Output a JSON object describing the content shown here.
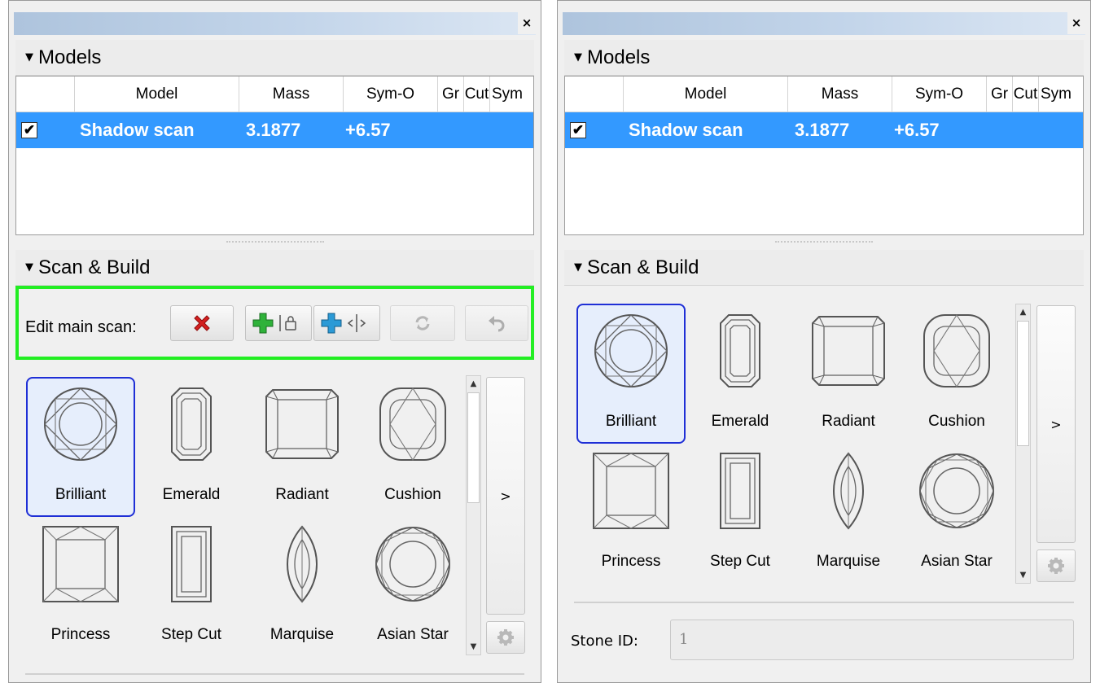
{
  "close_glyph": "×",
  "models": {
    "title": "Models",
    "columns": [
      "",
      "Model",
      "Mass",
      "Sym-O",
      "Gr",
      "Cut",
      "Sym"
    ],
    "rows": [
      {
        "checked": true,
        "check_glyph": "✔",
        "model": "Shadow scan",
        "mass": "3.1877",
        "sym_o": "+6.57"
      }
    ],
    "selection_color": "#3399ff"
  },
  "scan_build": {
    "title": "Scan & Build",
    "edit_label": "Edit main scan:",
    "buttons": [
      "delete-icon",
      "add-lock-icon",
      "add-mirror-icon",
      "refresh-icon",
      "undo-icon"
    ],
    "highlight_color": "#22ee22"
  },
  "cuts": [
    {
      "label": "Brilliant",
      "icon": "brilliant-cut-icon",
      "selected": true
    },
    {
      "label": "Emerald",
      "icon": "emerald-cut-icon",
      "selected": false
    },
    {
      "label": "Radiant",
      "icon": "radiant-cut-icon",
      "selected": false
    },
    {
      "label": "Cushion",
      "icon": "cushion-cut-icon",
      "selected": false
    },
    {
      "label": "Princess",
      "icon": "princess-cut-icon",
      "selected": false
    },
    {
      "label": "Step Cut",
      "icon": "step-cut-icon",
      "selected": false
    },
    {
      "label": "Marquise",
      "icon": "marquise-cut-icon",
      "selected": false
    },
    {
      "label": "Asian Star",
      "icon": "asian-star-cut-icon",
      "selected": false
    }
  ],
  "next_label": ">",
  "stone": {
    "label": "Stone ID:",
    "value": "1"
  }
}
